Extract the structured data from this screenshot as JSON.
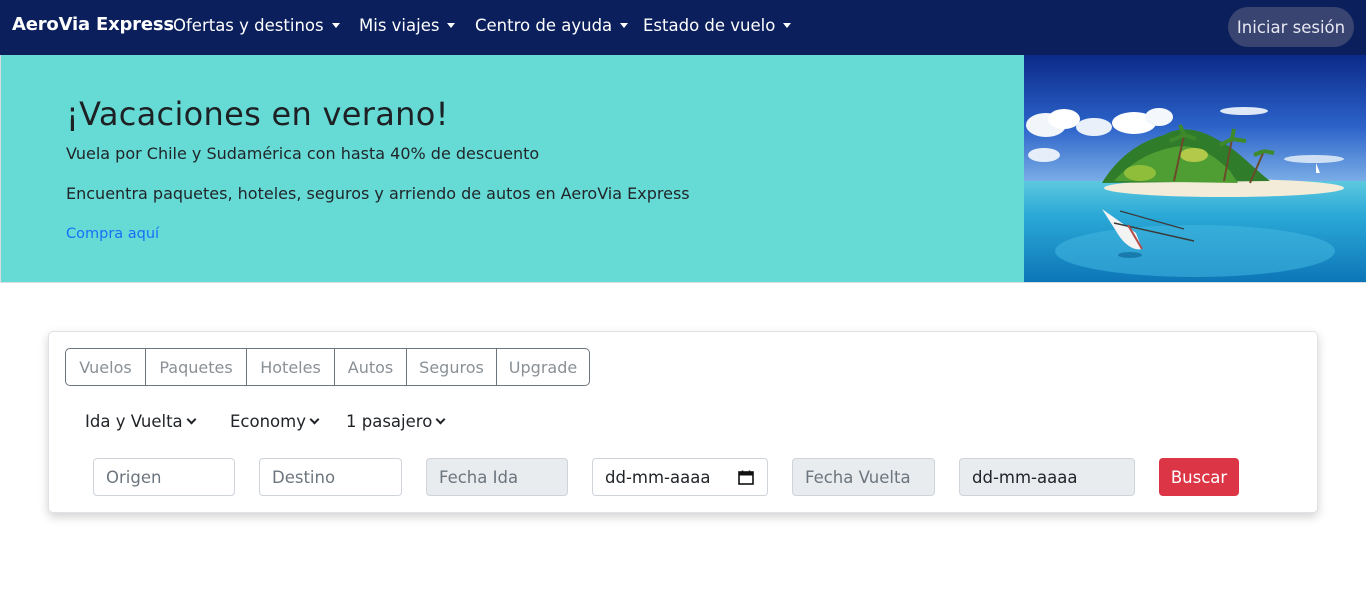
{
  "navbar": {
    "brand": "AeroVia Express",
    "items": [
      {
        "label": "Ofertas y destinos"
      },
      {
        "label": "Mis viajes"
      },
      {
        "label": "Centro de ayuda"
      },
      {
        "label": "Estado de vuelo"
      }
    ],
    "login_label": "Iniciar sesión"
  },
  "hero": {
    "title": "¡Vacaciones en verano!",
    "subtitle": "Vuela por Chile y Sudamérica con hasta 40% de descuento",
    "text": "Encuentra paquetes, hoteles, seguros y arriendo de autos en AeroVia Express",
    "link": "Compra aquí"
  },
  "search": {
    "tabs": [
      {
        "label": "Vuelos"
      },
      {
        "label": "Paquetes"
      },
      {
        "label": "Hoteles"
      },
      {
        "label": "Autos"
      },
      {
        "label": "Seguros"
      },
      {
        "label": "Upgrade"
      }
    ],
    "trip_type": "Ida y Vuelta",
    "cabin": "Economy",
    "passengers": "1 pasajero",
    "origin_placeholder": "Origen",
    "destination_placeholder": "Destino",
    "depart_label": "Fecha Ida",
    "depart_value": "dd-mm-aaaa",
    "return_label": "Fecha Vuelta",
    "return_value": "dd-mm-aaaa",
    "search_label": "Buscar"
  },
  "colors": {
    "navbar": "#0b1f5c",
    "hero_bg": "#66dbd6",
    "link": "#1a6ef5",
    "search_button": "#dc3545"
  }
}
